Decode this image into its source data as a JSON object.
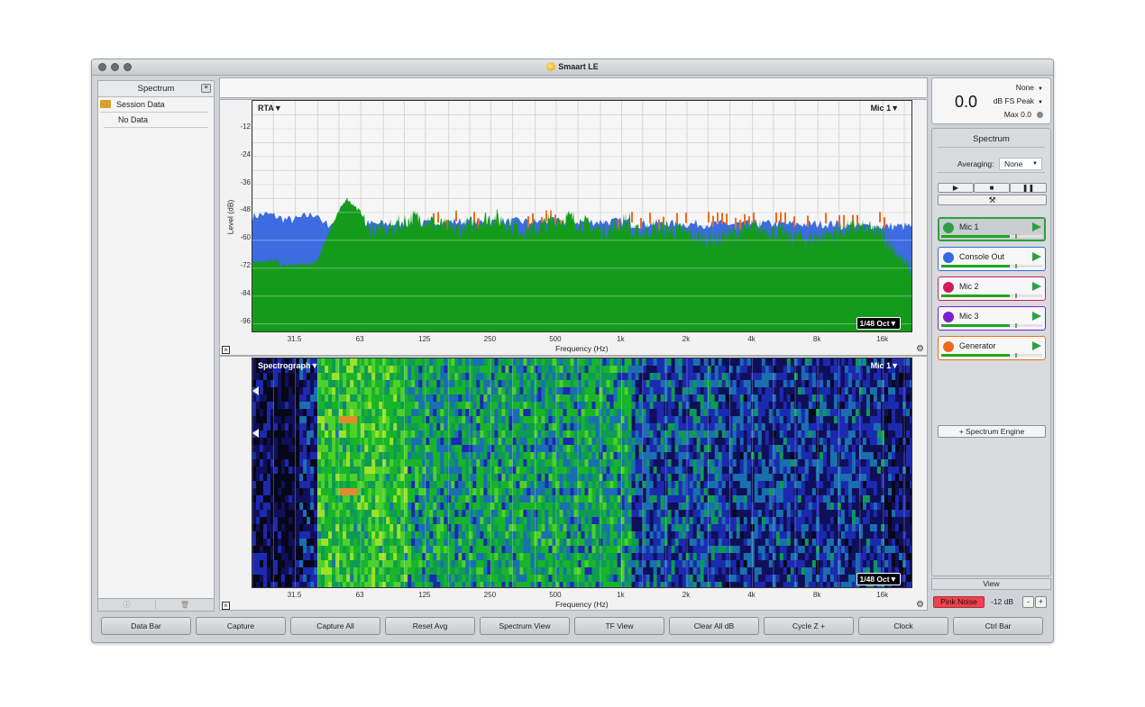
{
  "window": {
    "title": "Smaart LE"
  },
  "left_panel": {
    "title": "Spectrum",
    "items": [
      "Session Data",
      "No Data"
    ],
    "footer_icons": [
      "info-icon",
      "trash-icon"
    ]
  },
  "rta": {
    "mode": "RTA",
    "source": "Mic 1",
    "resolution": "1/48 Oct",
    "y_label": "Level (dB)",
    "x_label": "Frequency (Hz)",
    "y_ticks": [
      "-12",
      "-24",
      "-36",
      "-48",
      "-60",
      "-72",
      "-84",
      "-96"
    ],
    "x_ticks": [
      "31.5",
      "63",
      "125",
      "250",
      "500",
      "1k",
      "2k",
      "4k",
      "8k",
      "16k"
    ]
  },
  "spectrograph": {
    "mode": "Spectrograph",
    "source": "Mic 1",
    "resolution": "1/48 Oct",
    "x_label": "Frequency (Hz)",
    "x_ticks": [
      "31.5",
      "63",
      "125",
      "250",
      "500",
      "1k",
      "2k",
      "4k",
      "8k",
      "16k"
    ]
  },
  "meter": {
    "value": "0.0",
    "source": "None",
    "mode": "dB FS Peak",
    "max": "Max 0.0"
  },
  "control_panel": {
    "title": "Spectrum",
    "averaging_label": "Averaging:",
    "averaging_value": "None",
    "transport": [
      "▶",
      "■",
      "❚❚"
    ],
    "engines": [
      {
        "name": "Mic 1",
        "color": "#2ea043",
        "level": 0.68,
        "active": true
      },
      {
        "name": "Console Out",
        "color": "#3569e0",
        "level": 0.68,
        "active": false
      },
      {
        "name": "Mic 2",
        "color": "#d01c5a",
        "level": 0.68,
        "active": false
      },
      {
        "name": "Mic 3",
        "color": "#7a1fd0",
        "level": 0.68,
        "active": false
      },
      {
        "name": "Generator",
        "color": "#ef6a1c",
        "level": 0.68,
        "active": false
      }
    ],
    "add_engine": "+ Spectrum Engine",
    "view": "View",
    "generator_button": "Pink Noise",
    "generator_level": "-12 dB",
    "minus": "-",
    "plus": "+"
  },
  "bottom_bar": [
    "Data Bar",
    "Capture",
    "Capture All",
    "Reset Avg",
    "Spectrum View",
    "TF View",
    "Clear All dB",
    "Cycle Z +",
    "Clock",
    "Ctrl Bar"
  ]
}
